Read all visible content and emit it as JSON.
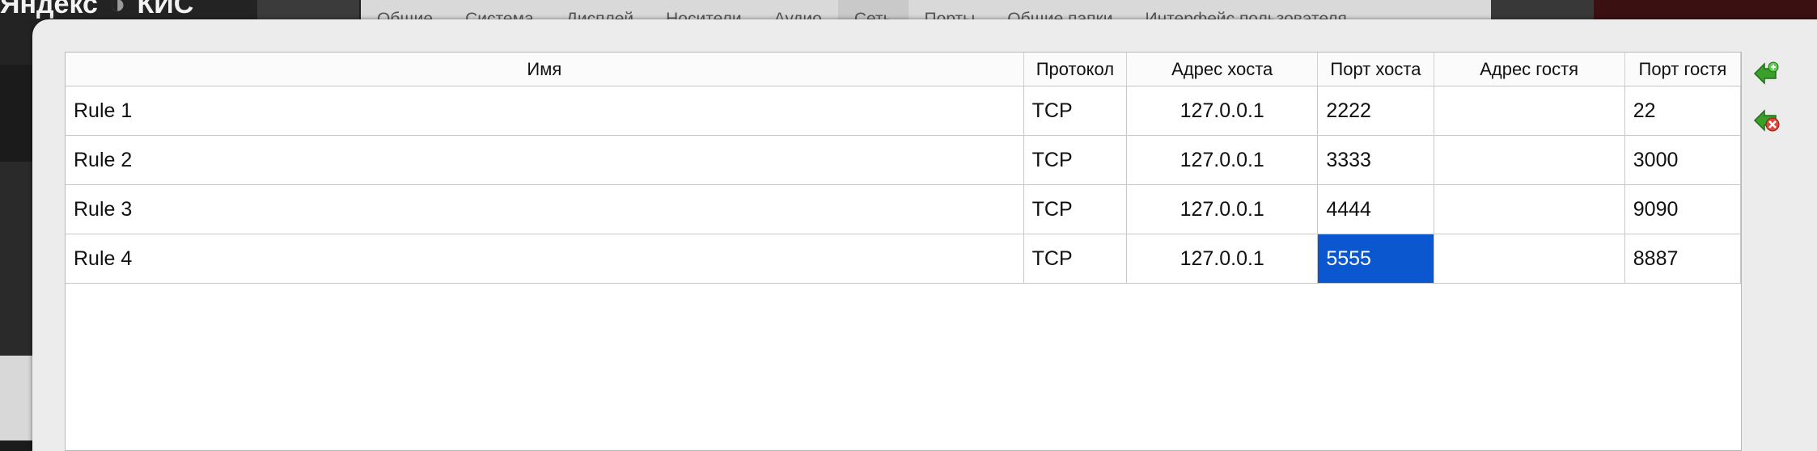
{
  "background": {
    "title_left": "Яндекс",
    "title_right": "КИС"
  },
  "tabs": [
    {
      "label": "Общие",
      "active": false
    },
    {
      "label": "Система",
      "active": false
    },
    {
      "label": "Дисплей",
      "active": false
    },
    {
      "label": "Носители",
      "active": false
    },
    {
      "label": "Аудио",
      "active": false
    },
    {
      "label": "Сеть",
      "active": true
    },
    {
      "label": "Порты",
      "active": false
    },
    {
      "label": "Общие папки",
      "active": false
    },
    {
      "label": "Интерфейс пользователя",
      "active": false
    }
  ],
  "table": {
    "columns": [
      "Имя",
      "Протокол",
      "Адрес хоста",
      "Порт хоста",
      "Адрес гостя",
      "Порт гостя"
    ],
    "rows": [
      {
        "name": "Rule 1",
        "protocol": "TCP",
        "host_ip": "127.0.0.1",
        "host_port": "2222",
        "guest_ip": "",
        "guest_port": "22"
      },
      {
        "name": "Rule 2",
        "protocol": "TCP",
        "host_ip": "127.0.0.1",
        "host_port": "3333",
        "guest_ip": "",
        "guest_port": "3000"
      },
      {
        "name": "Rule 3",
        "protocol": "TCP",
        "host_ip": "127.0.0.1",
        "host_port": "4444",
        "guest_ip": "",
        "guest_port": "9090"
      },
      {
        "name": "Rule 4",
        "protocol": "TCP",
        "host_ip": "127.0.0.1",
        "host_port": "5555",
        "guest_ip": "",
        "guest_port": "8887"
      }
    ],
    "selected_cell": {
      "row": 3,
      "column": "host_port"
    }
  },
  "actions": {
    "add_icon": "add-rule-icon",
    "remove_icon": "remove-rule-icon"
  },
  "colors": {
    "selection": "#0b57d0",
    "add_icon": "#3aa02a",
    "remove_icon": "#e0483a"
  }
}
